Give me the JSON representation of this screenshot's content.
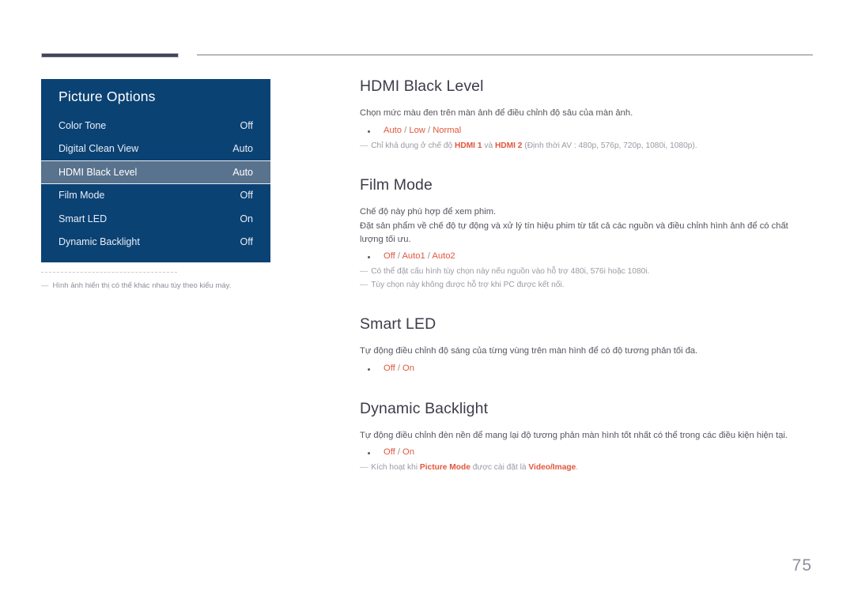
{
  "osd": {
    "title": "Picture Options",
    "rows": [
      {
        "label": "Color Tone",
        "value": "Off",
        "selected": false
      },
      {
        "label": "Digital Clean View",
        "value": "Auto",
        "selected": false
      },
      {
        "label": "HDMI Black Level",
        "value": "Auto",
        "selected": true
      },
      {
        "label": "Film Mode",
        "value": "Off",
        "selected": false
      },
      {
        "label": "Smart LED",
        "value": "On",
        "selected": false
      },
      {
        "label": "Dynamic Backlight",
        "value": "Off",
        "selected": false
      }
    ],
    "footnote_dash": "―",
    "footnote": "Hình ảnh hiển thị có thể khác nhau tùy theo kiểu máy."
  },
  "sections": {
    "hdmi_black_level": {
      "title": "HDMI Black Level",
      "desc": "Chọn mức màu đen trên màn ảnh để điều chỉnh độ sâu của màn ảnh.",
      "option_1": "Auto",
      "option_2": "Low",
      "option_3": "Normal",
      "sep": "/",
      "note_dash": "―",
      "note_pre": "Chỉ khả dụng ở chế độ ",
      "note_hdmi1": "HDMI 1",
      "note_mid": " và ",
      "note_hdmi2": "HDMI 2",
      "note_post": " (Định thời AV : 480p, 576p, 720p, 1080i, 1080p)."
    },
    "film_mode": {
      "title": "Film Mode",
      "desc_1": "Chế độ này phù hợp để xem phim.",
      "desc_2": "Đặt sản phẩm về chế độ tự động và xử lý tín hiệu phim từ tất cả các nguồn và điều chỉnh hình ảnh để có chất lượng tối ưu.",
      "option_1": "Off",
      "option_2": "Auto1",
      "option_3": "Auto2",
      "sep": "/",
      "note_dash": "―",
      "note_1": "Có thể đặt cấu hình tùy chọn này nếu nguồn vào hỗ trợ 480i, 576i hoặc 1080i.",
      "note_2": "Tùy chọn này không được hỗ trợ khi PC được kết nối."
    },
    "smart_led": {
      "title": "Smart LED",
      "desc": "Tự động điều chỉnh độ sáng của từng vùng trên màn hình để có độ tương phản tối đa.",
      "option_1": "Off",
      "option_2": "On",
      "sep": "/"
    },
    "dynamic_backlight": {
      "title": "Dynamic Backlight",
      "desc": "Tự động điều chỉnh đèn nền để mang lại độ tương phản màn hình tốt nhất có thể trong các điều kiện hiện tại.",
      "option_1": "Off",
      "option_2": "On",
      "sep": "/",
      "note_dash": "―",
      "note_pre": "Kích hoạt khi ",
      "note_term_1": "Picture Mode",
      "note_mid": " được cài đặt là ",
      "note_term_2": "Video/Image",
      "note_post": "."
    }
  },
  "page_number": "75",
  "colors": {
    "osd_panel_bg": "#0b4274",
    "osd_selected_bg": "#59728d",
    "accent_orange": "#e2563c",
    "rule_dark": "#44445a"
  }
}
